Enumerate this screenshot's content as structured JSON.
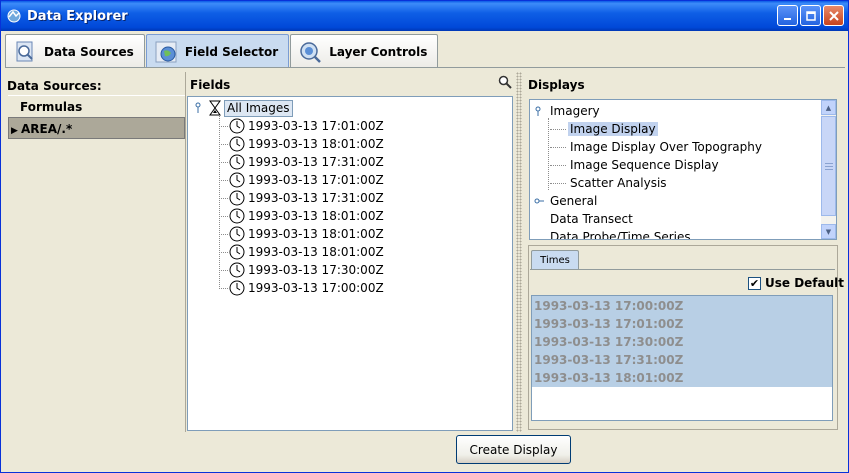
{
  "window": {
    "title": "Data Explorer",
    "title_bar_color": "#0054e3"
  },
  "tabs": [
    {
      "label": "Data Sources",
      "icon": "magnifier-doc-icon"
    },
    {
      "label": "Field Selector",
      "icon": "globe-icon",
      "active": true
    },
    {
      "label": "Layer Controls",
      "icon": "magnifier-globe-icon"
    }
  ],
  "data_sources": {
    "header": "Data Sources:",
    "items": [
      {
        "label": "Formulas",
        "selected": false
      },
      {
        "label": "AREA/.*",
        "selected": true
      }
    ]
  },
  "fields": {
    "header": "Fields",
    "root_label": "All Images",
    "items": [
      "1993-03-13 17:01:00Z",
      "1993-03-13 18:01:00Z",
      "1993-03-13 17:31:00Z",
      "1993-03-13 17:01:00Z",
      "1993-03-13 17:31:00Z",
      "1993-03-13 18:01:00Z",
      "1993-03-13 18:01:00Z",
      "1993-03-13 18:01:00Z",
      "1993-03-13 17:30:00Z",
      "1993-03-13 17:00:00Z"
    ]
  },
  "displays": {
    "header": "Displays",
    "imagery": "Imagery",
    "imagery_children": [
      {
        "label": "Image Display",
        "selected": true
      },
      {
        "label": "Image Display Over Topography"
      },
      {
        "label": "Image Sequence Display"
      },
      {
        "label": "Scatter Analysis"
      }
    ],
    "general": "General",
    "general_children": [
      "Data Transect",
      "Data Probe/Time Series"
    ]
  },
  "times": {
    "tab_label": "Times",
    "use_default_label": "Use Default",
    "use_default_checked": true,
    "items": [
      "1993-03-13 17:00:00Z",
      "1993-03-13 17:01:00Z",
      "1993-03-13 17:30:00Z",
      "1993-03-13 17:31:00Z",
      "1993-03-13 18:01:00Z"
    ]
  },
  "create_button": "Create Display"
}
